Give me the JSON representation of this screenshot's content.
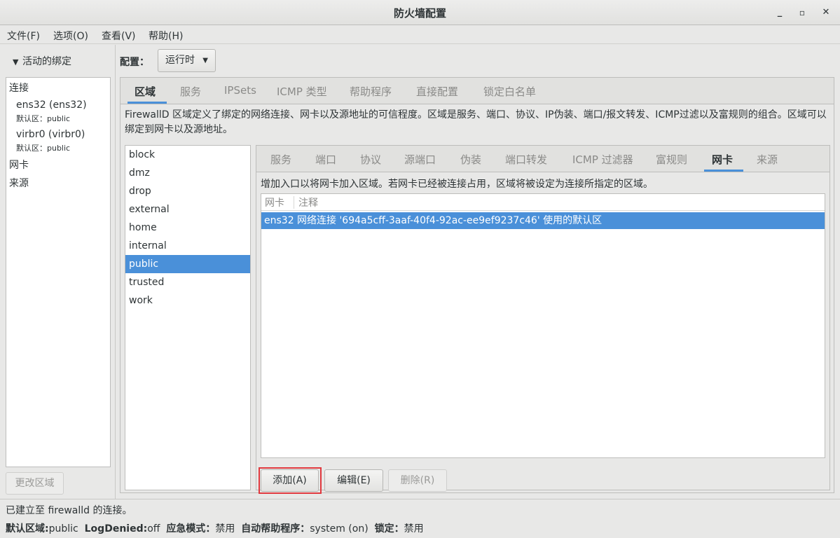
{
  "window": {
    "title": "防火墙配置",
    "controls": {
      "minimize": "_",
      "maximize": "▫",
      "close": "✕"
    }
  },
  "menu": [
    "文件(F)",
    "选项(O)",
    "查看(V)",
    "帮助(H)"
  ],
  "left": {
    "expander": "活动的绑定",
    "bindings": {
      "connections_label": "连接",
      "conn1_name": "ens32 (ens32)",
      "conn1_zone": "默认区：public",
      "conn2_name": "virbr0 (virbr0)",
      "conn2_zone": "默认区：public",
      "nics_label": "网卡",
      "sources_label": "来源"
    },
    "change_zone_button": "更改区域"
  },
  "config": {
    "label": "配置：",
    "mode": "运行时"
  },
  "top_tabs": [
    "区域",
    "服务",
    "IPSets",
    "ICMP 类型",
    "帮助程序",
    "直接配置",
    "锁定白名单"
  ],
  "zone_description": "FirewallD 区域定义了绑定的网络连接、网卡以及源地址的可信程度。区域是服务、端口、协议、IP伪装、端口/报文转发、ICMP过滤以及富规则的组合。区域可以绑定到网卡以及源地址。",
  "zones": [
    "block",
    "dmz",
    "drop",
    "external",
    "home",
    "internal",
    "public",
    "trusted",
    "work"
  ],
  "zone_tabs": [
    "服务",
    "端口",
    "协议",
    "源端口",
    "伪装",
    "端口转发",
    "ICMP 过滤器",
    "富规则",
    "网卡",
    "来源"
  ],
  "interfaces": {
    "description": "增加入口以将网卡加入区域。若网卡已经被连接占用，区域将被设定为连接所指定的区域。",
    "col_nic": "网卡",
    "col_comment": "注释",
    "rows": [
      {
        "nic": "ens32",
        "comment": "网络连接 '694a5cff-3aaf-40f4-92ac-ee9ef9237c46' 使用的默认区"
      }
    ],
    "add_button": "添加(A)",
    "edit_button": "编辑(E)",
    "delete_button": "删除(R)"
  },
  "status": {
    "line1": "已建立至 firewalld 的连接。",
    "default_zone_label": "默认区域:",
    "default_zone_value": "public",
    "log_denied_label": "LogDenied:",
    "log_denied_value": "off",
    "panic_label": "应急模式：",
    "panic_value": "禁用",
    "helpers_label": "自动帮助程序：",
    "helpers_value": "system (on)",
    "lockdown_label": "锁定：",
    "lockdown_value": "禁用"
  },
  "colors": {
    "selection": "#4a90d9",
    "highlight_border": "#e0393e"
  }
}
